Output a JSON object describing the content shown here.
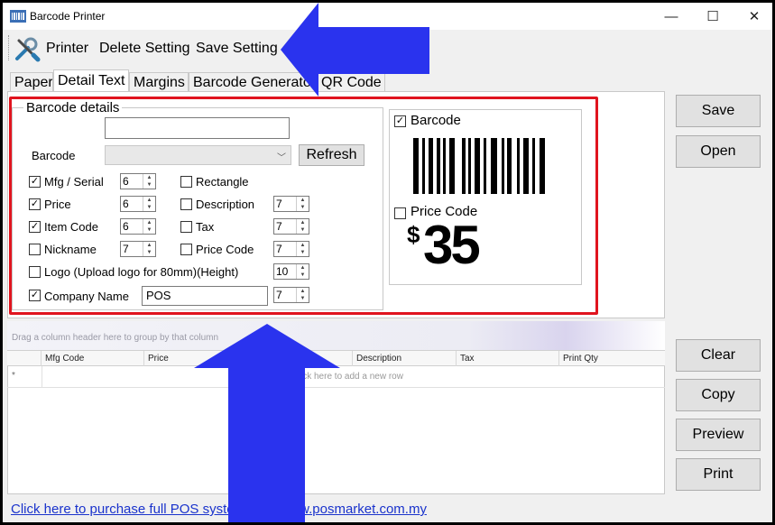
{
  "window": {
    "title": "Barcode Printer",
    "minimize": "—",
    "maximize": "☐",
    "close": "✕"
  },
  "toolbar": {
    "printer": "Printer",
    "delete_setting": "Delete Setting",
    "save_setting": "Save Setting"
  },
  "tabs": [
    {
      "label": "Paper",
      "active": false
    },
    {
      "label": "Detail Text",
      "active": true
    },
    {
      "label": "Margins",
      "active": false
    },
    {
      "label": "Barcode Generator",
      "active": false
    },
    {
      "label": "QR Code",
      "active": false
    }
  ],
  "barcode_details": {
    "title": "Barcode details",
    "top_input": "",
    "barcode_label": "Barcode",
    "barcode_select": "",
    "refresh": "Refresh",
    "options": [
      {
        "label": "Mfg / Serial",
        "checked": true,
        "value": "6"
      },
      {
        "label": "Price",
        "checked": true,
        "value": "6"
      },
      {
        "label": "Item Code",
        "checked": true,
        "value": "6"
      },
      {
        "label": "Nickname",
        "checked": false,
        "value": "7"
      },
      {
        "label": "Rectangle",
        "checked": false,
        "value": ""
      },
      {
        "label": "Description",
        "checked": false,
        "value": "7"
      },
      {
        "label": "Tax",
        "checked": false,
        "value": "7"
      },
      {
        "label": "Price Code",
        "checked": false,
        "value": "7"
      },
      {
        "label": "Logo (Upload logo for 80mm)(Height)",
        "checked": false,
        "value": "10"
      },
      {
        "label": "Company Name",
        "checked": true,
        "value": "7"
      }
    ],
    "company_name_value": "POS"
  },
  "preview": {
    "barcode_label": "Barcode",
    "barcode_checked": true,
    "price_code_label": "Price Code",
    "price_code_checked": false,
    "currency": "$",
    "amount": "35"
  },
  "grid": {
    "group_hint": "Drag a column header here to group by that column",
    "columns": [
      "Mfg Code",
      "Price",
      "",
      "Description",
      "Tax",
      "Print Qty"
    ],
    "new_row_marker": "*",
    "new_row_text": "ick here to add a new row"
  },
  "side_buttons": {
    "save": "Save",
    "open": "Open",
    "clear": "Clear",
    "copy": "Copy",
    "preview": "Preview",
    "print": "Print"
  },
  "footer_link": "Click here to purchase full POS system from www.posmarket.com.my",
  "colors": {
    "highlight": "#e0141e",
    "arrow": "#2a33ee",
    "link": "#1a33cc"
  }
}
